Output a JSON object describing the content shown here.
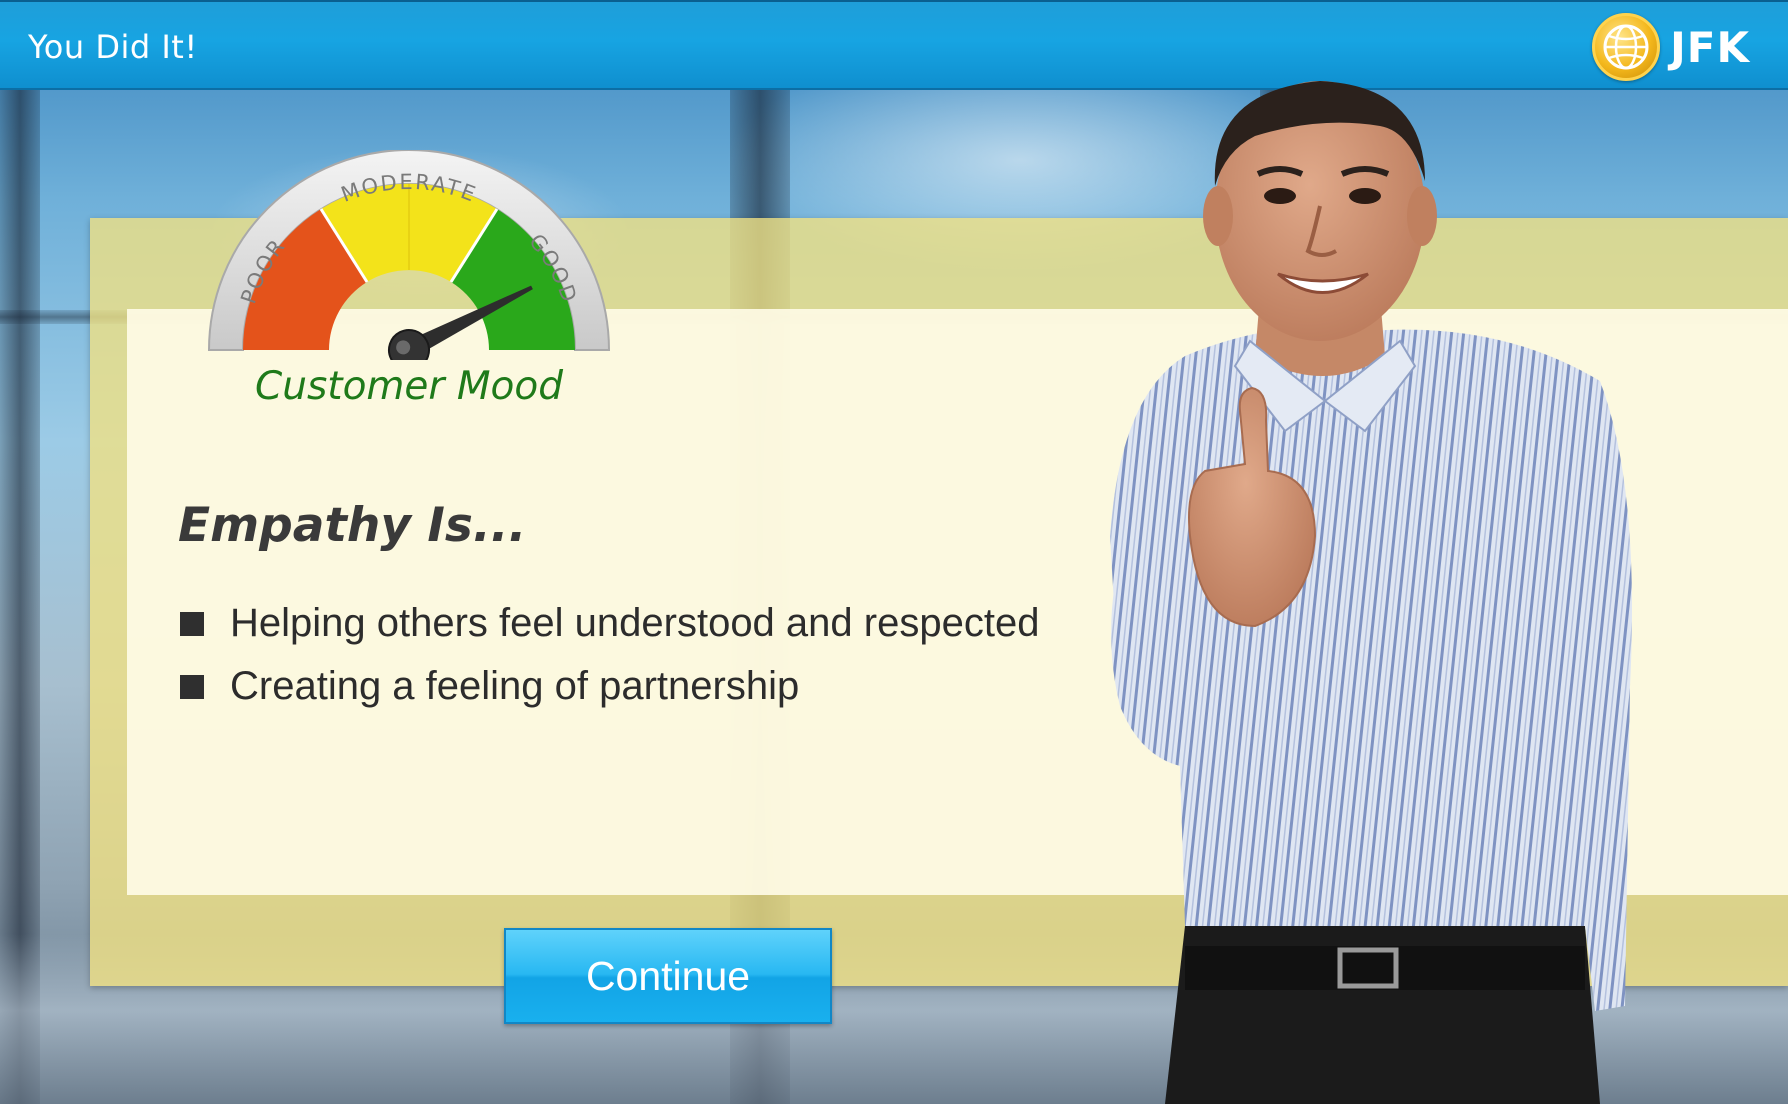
{
  "window": {
    "title": "You Did It!"
  },
  "brand": {
    "logo_text": "JFK",
    "logo_icon": "globe-icon",
    "accent": "#f4b81c"
  },
  "gauge": {
    "labels": {
      "poor": "POOR",
      "moderate": "MODERATE",
      "good": "GOOD"
    },
    "caption": "Customer Mood",
    "level": 0.85,
    "colors": {
      "poor": "#e4531b",
      "moderate": "#f3e31a",
      "good": "#2aa81b"
    }
  },
  "content": {
    "heading": "Empathy Is...",
    "bullets": [
      "Helping others feel understood and respected",
      "Creating a feeling of partnership"
    ]
  },
  "actions": {
    "continue_label": "Continue"
  },
  "colors": {
    "titlebar": "#17a4e2",
    "panel": "#f2e182",
    "button": "#28b8f2"
  }
}
